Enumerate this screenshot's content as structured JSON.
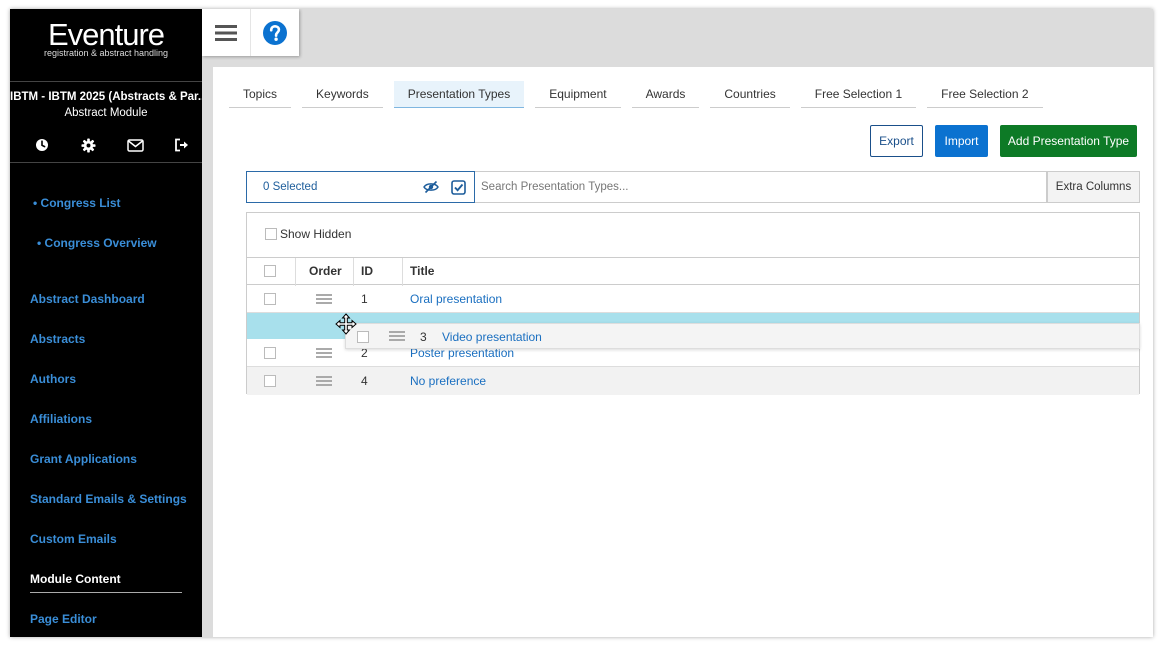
{
  "brand": {
    "name": "Eventure",
    "tagline": "registration & abstract handling"
  },
  "congress": {
    "title": "IBTM - IBTM 2025 (Abstracts & Par...",
    "module": "Abstract Module"
  },
  "sidebar_icons": [
    "clock-icon",
    "gear-icon",
    "envelope-icon",
    "logout-icon"
  ],
  "nav": {
    "congress_list": "• Congress List",
    "congress_overview": "• Congress Overview",
    "abstract_dashboard": "Abstract Dashboard",
    "abstracts": "Abstracts",
    "authors": "Authors",
    "affiliations": "Affiliations",
    "grant_applications": "Grant Applications",
    "standard_emails": "Standard Emails & Settings",
    "custom_emails": "Custom Emails",
    "module_content": "Module Content",
    "page_editor": "Page Editor"
  },
  "tabs": [
    "Topics",
    "Keywords",
    "Presentation Types",
    "Equipment",
    "Awards",
    "Countries",
    "Free Selection 1",
    "Free Selection 2"
  ],
  "active_tab": "Presentation Types",
  "toolbar": {
    "export": "Export",
    "import": "Import",
    "add": "Add Presentation Type"
  },
  "selection": {
    "label": "0 Selected"
  },
  "search": {
    "placeholder": "Search Presentation Types..."
  },
  "extra_columns": "Extra Columns",
  "show_hidden": "Show Hidden",
  "table": {
    "headers": {
      "order": "Order",
      "id": "ID",
      "title": "Title"
    },
    "rows": [
      {
        "id": "1",
        "title": "Oral presentation"
      },
      {
        "id": "2",
        "title": "Poster presentation"
      },
      {
        "id": "4",
        "title": "No preference"
      }
    ],
    "dragging": {
      "id": "3",
      "title": "Video presentation"
    }
  },
  "colors": {
    "accent_blue": "#0b72d0",
    "add_green": "#0d7a26",
    "drop_highlight": "#a8e0ec",
    "nav_link": "#3a8ed8"
  }
}
